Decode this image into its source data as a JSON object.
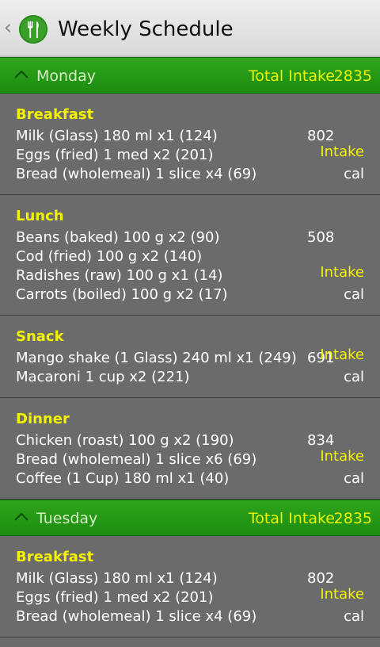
{
  "app": {
    "title": "Weekly Schedule",
    "accent": "#2fa51c",
    "icon": "fork-knife-icon"
  },
  "days": [
    {
      "name": "Monday",
      "total_label": "Total Intake",
      "total_value": "2835",
      "meals": [
        {
          "name": "Breakfast",
          "items": [
            "Milk (Glass) 180 ml x1 (124)",
            "Eggs (fried) 1 med x2 (201)",
            "Bread (wholemeal) 1 slice x4 (69)"
          ],
          "intake_value": "802",
          "intake_label": "Intake",
          "unit": "cal"
        },
        {
          "name": "Lunch",
          "items": [
            "Beans (baked) 100 g x2 (90)",
            "Cod (fried) 100 g x2 (140)",
            "Radishes (raw) 100 g x1 (14)",
            "Carrots (boiled) 100 g x2 (17)"
          ],
          "intake_value": "508",
          "intake_label": "Intake",
          "unit": "cal"
        },
        {
          "name": "Snack",
          "items": [
            "Mango shake (1 Glass) 240 ml x1 (249)",
            "Macaroni 1 cup  x2 (221)"
          ],
          "intake_value": "691",
          "intake_label": "Intake",
          "unit": "cal"
        },
        {
          "name": "Dinner",
          "items": [
            "Chicken (roast) 100 g x2 (190)",
            "Bread (wholemeal) 1 slice x6 (69)",
            "Coffee (1 Cup) 180 ml x1 (40)"
          ],
          "intake_value": "834",
          "intake_label": "Intake",
          "unit": "cal"
        }
      ]
    },
    {
      "name": "Tuesday",
      "total_label": "Total Intake",
      "total_value": "2835",
      "meals": [
        {
          "name": "Breakfast",
          "items": [
            "Milk (Glass) 180 ml x1 (124)",
            "Eggs (fried) 1 med x2 (201)",
            "Bread (wholemeal) 1 slice x4 (69)"
          ],
          "intake_value": "802",
          "intake_label": "Intake",
          "unit": "cal"
        }
      ]
    }
  ]
}
